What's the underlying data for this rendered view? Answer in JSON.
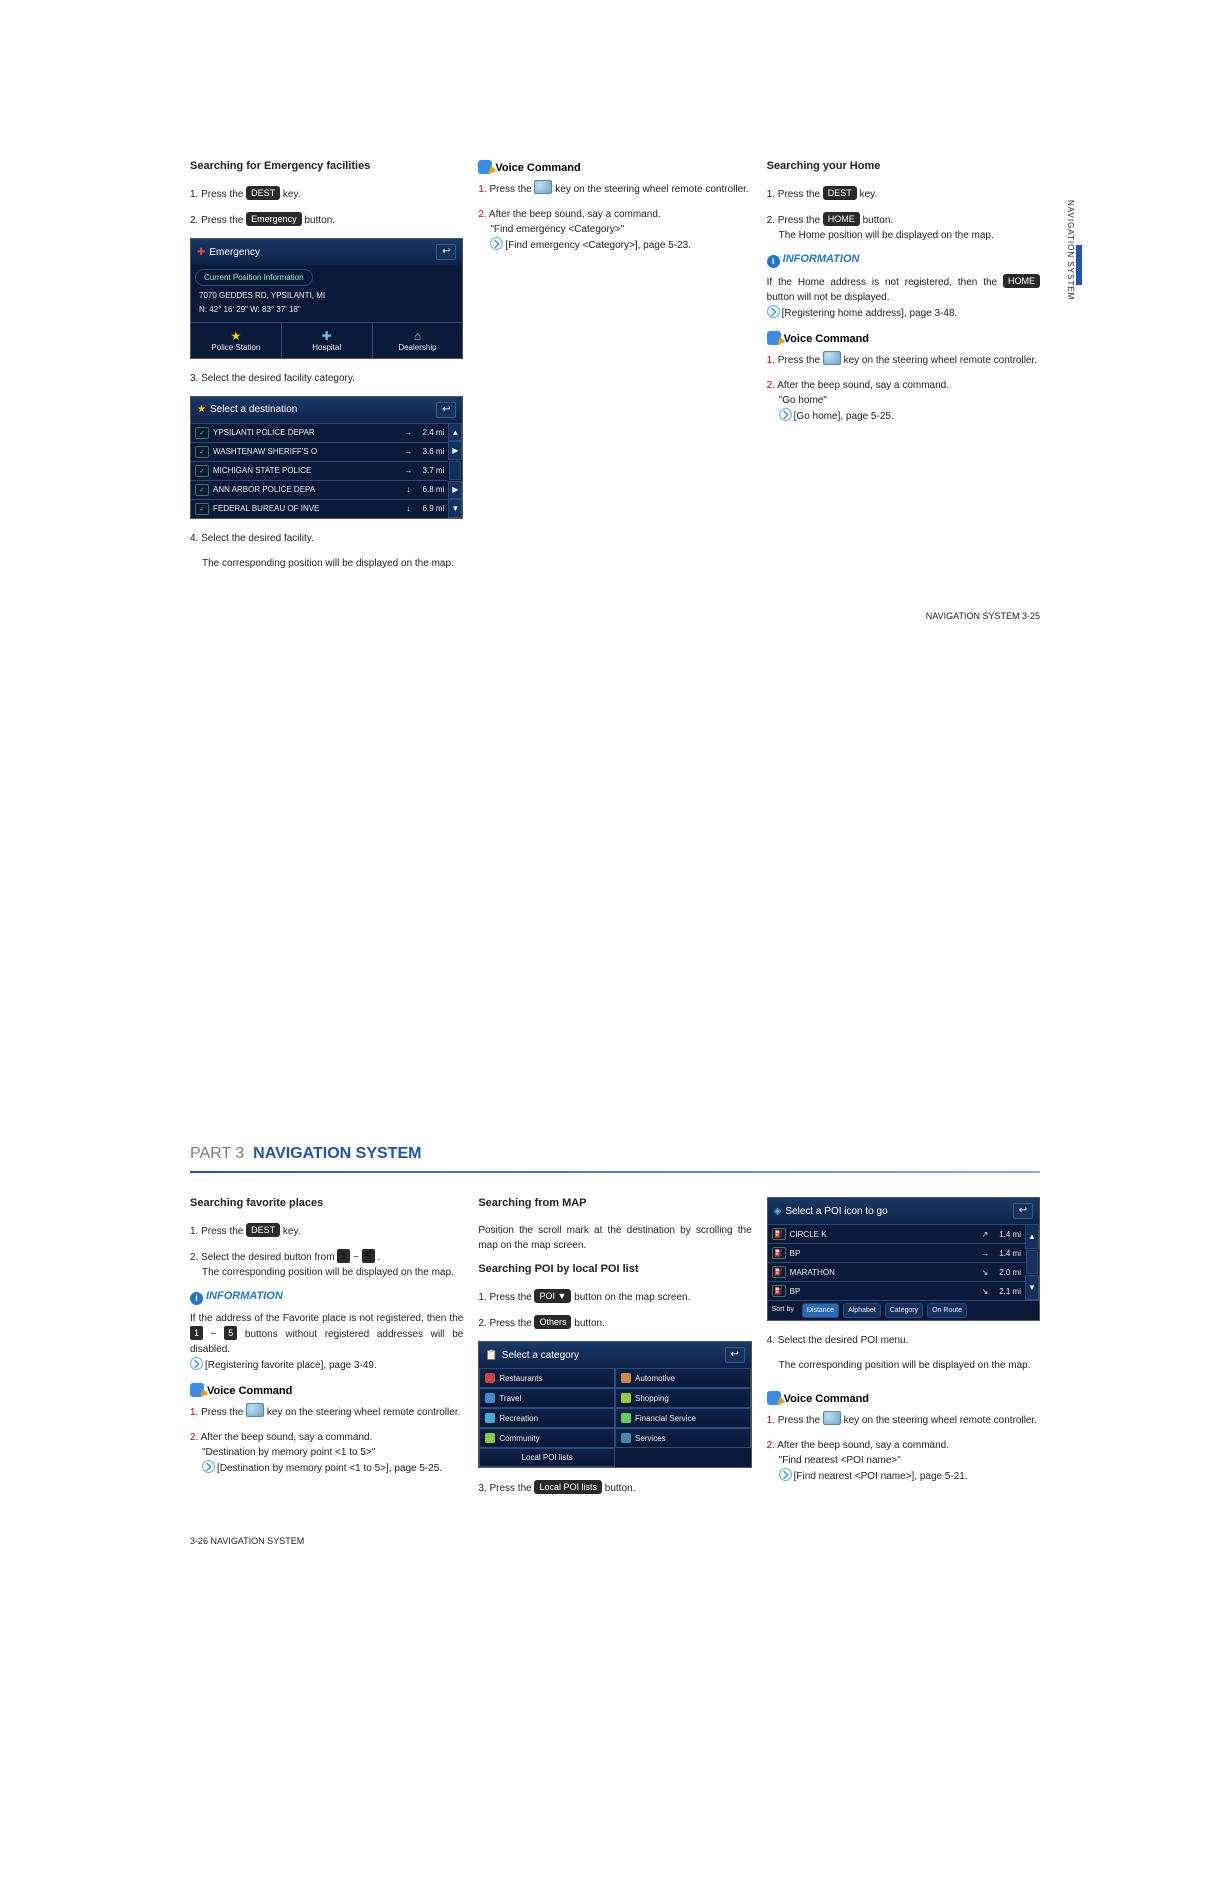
{
  "page325": {
    "side_label": "NAVIGATION SYSTEM",
    "footer": "NAVIGATION SYSTEM   3-25",
    "col1": {
      "heading": "Searching for Emergency facilities",
      "step1_a": "1. Press the ",
      "step1_btn": "DEST",
      "step1_b": " key.",
      "step2_a": "2. Press the ",
      "step2_btn": "Emergency",
      "step2_b": " button.",
      "ss1": {
        "title": "Emergency",
        "cpi": "Current Position Information",
        "addr1": "7070 GEDDES RD, YPSILANTI, MI",
        "addr2": "N: 42° 16' 29\"   W: 83° 37' 18\"",
        "b1": "Police Station",
        "b2": "Hospital",
        "b3": "Dealership"
      },
      "step3": "3. Select the desired facility category.",
      "ss2": {
        "title": "Select a destination",
        "r1n": "YPSILANTI POLICE DEPAR",
        "r1a": "→",
        "r1d": "2.4 mi",
        "r2n": "WASHTENAW SHERIFF'S O",
        "r2a": "→",
        "r2d": "3.6 mi",
        "r3n": "MICHIGAN STATE POLICE",
        "r3a": "→",
        "r3d": "3.7 mi",
        "r4n": "ANN ARBOR POLICE DEPA",
        "r4a": "↓",
        "r4d": "6.8 mi",
        "r5n": "FEDERAL BUREAU OF INVE",
        "r5a": "↓",
        "r5d": "6.9 mi"
      },
      "step4": "4. Select the desired facility.",
      "step4b": "The corresponding position will be displayed on the map."
    },
    "col2": {
      "heading": "Voice Command",
      "s1a": "Press the ",
      "s1b": " key on the steering wheel remote controller.",
      "s2": "After the beep sound, say a command.",
      "s2q": "\"Find emergency <Category>\"",
      "s2r": "[Find emergency <Category>], page 5-23."
    },
    "col3": {
      "h1": "Searching your Home",
      "s1a": "1. Press the ",
      "s1btn": "DEST",
      "s1b": " key.",
      "s2a": "2. Press the ",
      "s2btn": "HOME",
      "s2b": " button.",
      "s2c": "The Home position will be displayed on the map.",
      "info_h": "INFORMATION",
      "info_a": "If the Home address is not registered, then the ",
      "info_btn": "HOME",
      "info_b": " button will not be displayed.",
      "info_ref": "[Registering home address], page 3-48.",
      "vc_h": "Voice Command",
      "vc1a": "Press the ",
      "vc1b": " key on the steering wheel remote controller.",
      "vc2": "After the beep sound, say a command.",
      "vc2q": "\"Go home\"",
      "vc2r": "[Go home], page 5-25."
    }
  },
  "page326": {
    "part": "PART 3",
    "part_name": "NAVIGATION SYSTEM",
    "footer": "3-26   NAVIGATION SYSTEM",
    "col1": {
      "h": "Searching favorite places",
      "s1a": "1. Press the ",
      "s1btn": "DEST",
      "s1b": " key.",
      "s2a": "2. Select the desired button from ",
      "s2n1": "1",
      "s2mid": " ~ ",
      "s2n5": "5",
      "s2b": " .",
      "s2c": "The corresponding position will be displayed on the map.",
      "info_h": "INFORMATION",
      "info_a": "If the address of the Favorite place is not registered, then the ",
      "info_n1": "1",
      "info_mid": " ~ ",
      "info_n5": "5",
      "info_b": " buttons without registered addresses will be disabled.",
      "info_ref": "[Registering favorite place], page 3-49.",
      "vc_h": "Voice Command",
      "vc1a": "Press the ",
      "vc1b": " key on the steering wheel remote controller.",
      "vc2": "After the beep sound, say a command.",
      "vc2q": "\"Destination by memory point <1 to 5>\"",
      "vc2r": "[Destination by memory point <1 to 5>], page 5-25."
    },
    "col2": {
      "h1": "Searching from MAP",
      "p1": "Position the scroll mark at the destination by scrolling the map on the map screen.",
      "h2": "Searching POI by local POI list",
      "s1a": "1. Press the ",
      "s1btn": "POI ▼",
      "s1b": " button on the map screen.",
      "s2a": "2. Press the ",
      "s2btn": "Others",
      "s2b": " button.",
      "ss_cat": {
        "title": "Select a category",
        "c1": "Restaurants",
        "c2": "Automotive",
        "c3": "Travel",
        "c4": "Shopping",
        "c5": "Recreation",
        "c6": "Financial Service",
        "c7": "Community",
        "c8": "Services",
        "c9": "Local POI lists"
      },
      "s3a": "3. Press the ",
      "s3btn": "Local POI lists",
      "s3b": " button."
    },
    "col3": {
      "ss_poi": {
        "title": "Select a POI icon to go",
        "r1n": "CIRCLE K",
        "r1a": "↗",
        "r1d": "1.4 mi",
        "r2n": "BP",
        "r2a": "→",
        "r2d": "1.4 mi",
        "r3n": "MARATHON",
        "r3a": "↘",
        "r3d": "2.0 mi",
        "r4n": "BP",
        "r4a": "↘",
        "r4d": "2.1 mi",
        "sort_lbl": "Sort by",
        "sb1": "Distance",
        "sb2": "Alphabet",
        "sb3": "Category",
        "sb4": "On Route"
      },
      "s4": "4. Select the desired POI menu.",
      "s4b": "The corresponding position will be displayed on the map.",
      "vc_h": "Voice Command",
      "vc1a": "Press the ",
      "vc1b": " key on the steering wheel remote controller.",
      "vc2": "After the beep sound, say a command.",
      "vc2q": "\"Find nearest <POI name>\"",
      "vc2r": "[Find nearest <POI name>], page 5-21."
    }
  }
}
